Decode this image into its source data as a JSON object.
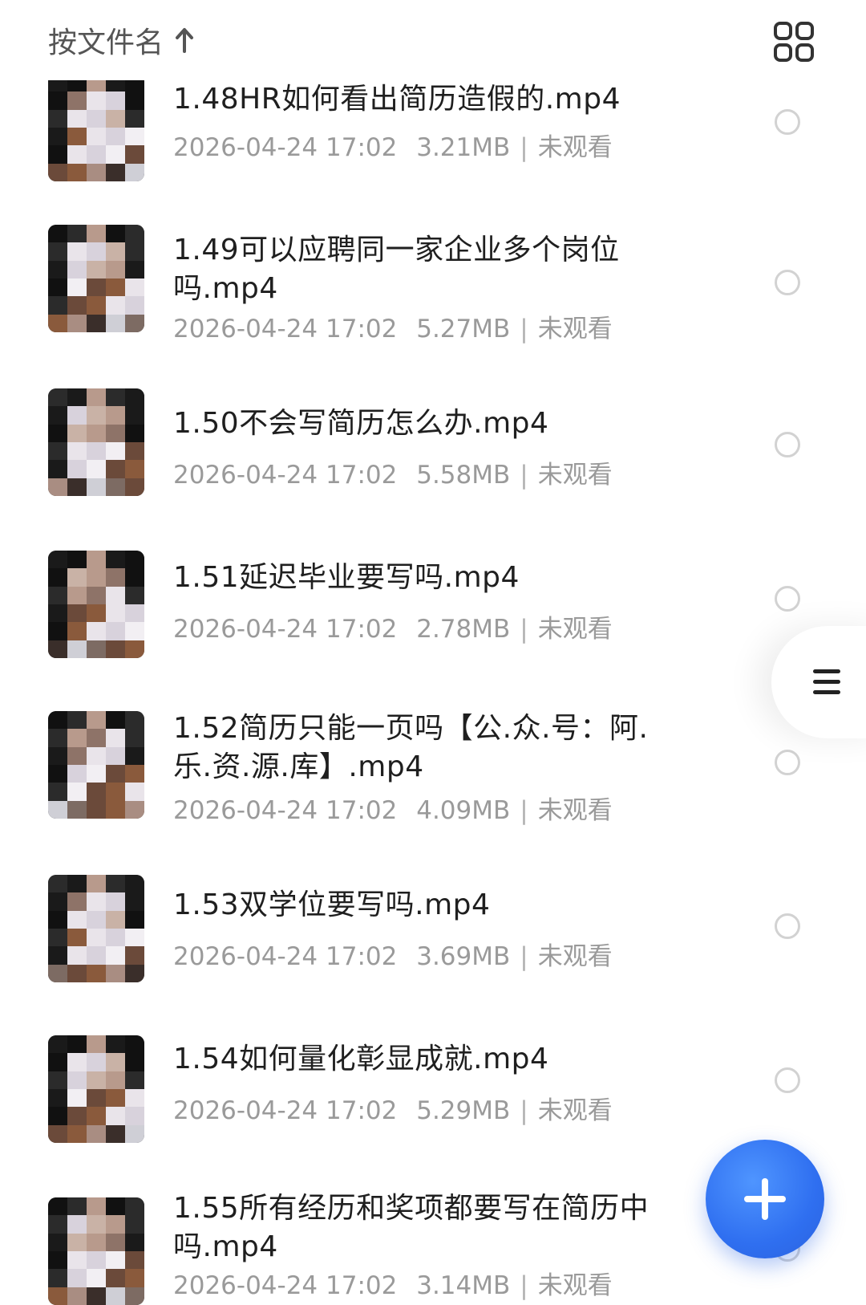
{
  "header": {
    "sort_label": "按文件名",
    "sort_icon": "arrow-up-icon",
    "view_icon": "grid-view-icon"
  },
  "files": [
    {
      "title": "1.48HR如何看出简历造假的.mp4",
      "date": "2026-04-24 17:02",
      "size": "3.21MB",
      "status": "未观看"
    },
    {
      "title": "1.49可以应聘同一家企业多个岗位吗.mp4",
      "date": "2026-04-24 17:02",
      "size": "5.27MB",
      "status": "未观看"
    },
    {
      "title": "1.50不会写简历怎么办.mp4",
      "date": "2026-04-24 17:02",
      "size": "5.58MB",
      "status": "未观看"
    },
    {
      "title": "1.51延迟毕业要写吗.mp4",
      "date": "2026-04-24 17:02",
      "size": "2.78MB",
      "status": "未观看"
    },
    {
      "title": "1.52简历只能一页吗【公.众.号：阿.乐.资.源.库】.mp4",
      "date": "2026-04-24 17:02",
      "size": "4.09MB",
      "status": "未观看"
    },
    {
      "title": "1.53双学位要写吗.mp4",
      "date": "2026-04-24 17:02",
      "size": "3.69MB",
      "status": "未观看"
    },
    {
      "title": "1.54如何量化彰显成就.mp4",
      "date": "2026-04-24 17:02",
      "size": "5.29MB",
      "status": "未观看"
    },
    {
      "title": "1.55所有经历和奖项都要写在简历中吗.mp4",
      "date": "2026-04-24 17:02",
      "size": "3.14MB",
      "status": "未观看"
    }
  ],
  "side_handle_icon": "menu-icon",
  "fab_icon": "plus-icon",
  "colors": {
    "accent": "#2f6ff0",
    "meta_text": "#9a9a9a",
    "title_text": "#1f1f1f"
  }
}
